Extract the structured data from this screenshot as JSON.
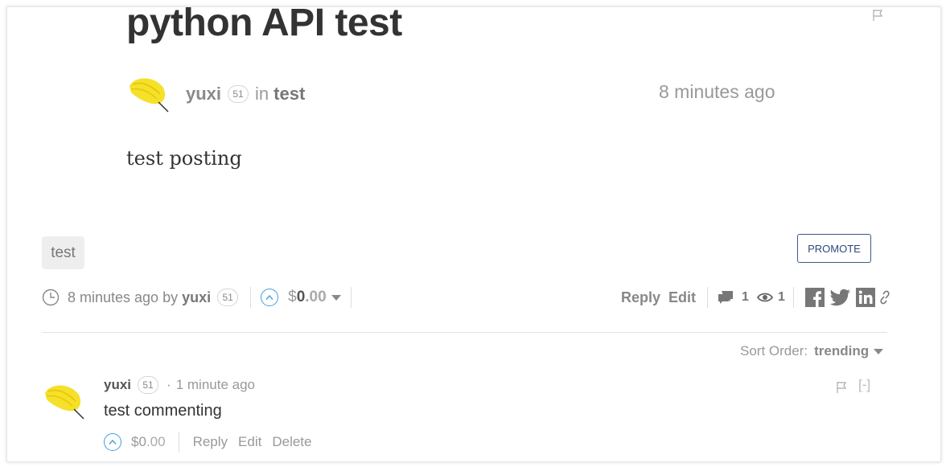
{
  "post": {
    "title": "python API test",
    "author": "yuxi",
    "author_rep": "51",
    "in_label": "in",
    "category": "test",
    "time_ago": "8 minutes ago",
    "body": "test posting"
  },
  "tags": [
    "test"
  ],
  "promote_label": "PROMOTE",
  "footer": {
    "time_by": "8 minutes ago by",
    "author": "yuxi",
    "author_rep": "51",
    "payout_currency": "$",
    "payout_whole": "0",
    "payout_cents": ".00",
    "reply_label": "Reply",
    "edit_label": "Edit",
    "comments_count": "1",
    "views_count": "1"
  },
  "sort": {
    "label": "Sort Order:",
    "value": "trending"
  },
  "comment": {
    "author": "yuxi",
    "author_rep": "51",
    "separator": "·",
    "time_ago": "1 minute ago",
    "body": "test commenting",
    "payout_currency": "$",
    "payout_whole": "0",
    "payout_cents": ".00",
    "reply_label": "Reply",
    "edit_label": "Edit",
    "delete_label": "Delete",
    "collapse_label": "[-]"
  },
  "colors": {
    "vote_blue": "#3fa0dc",
    "promote_blue": "#2c4a7c",
    "avatar_yellow": "#f5e02a"
  },
  "icons": [
    "flag-icon",
    "feather-avatar",
    "clock-icon",
    "upvote-icon",
    "caret-down-icon",
    "comments-icon",
    "eye-icon",
    "facebook-icon",
    "twitter-icon",
    "linkedin-icon",
    "link-icon"
  ]
}
